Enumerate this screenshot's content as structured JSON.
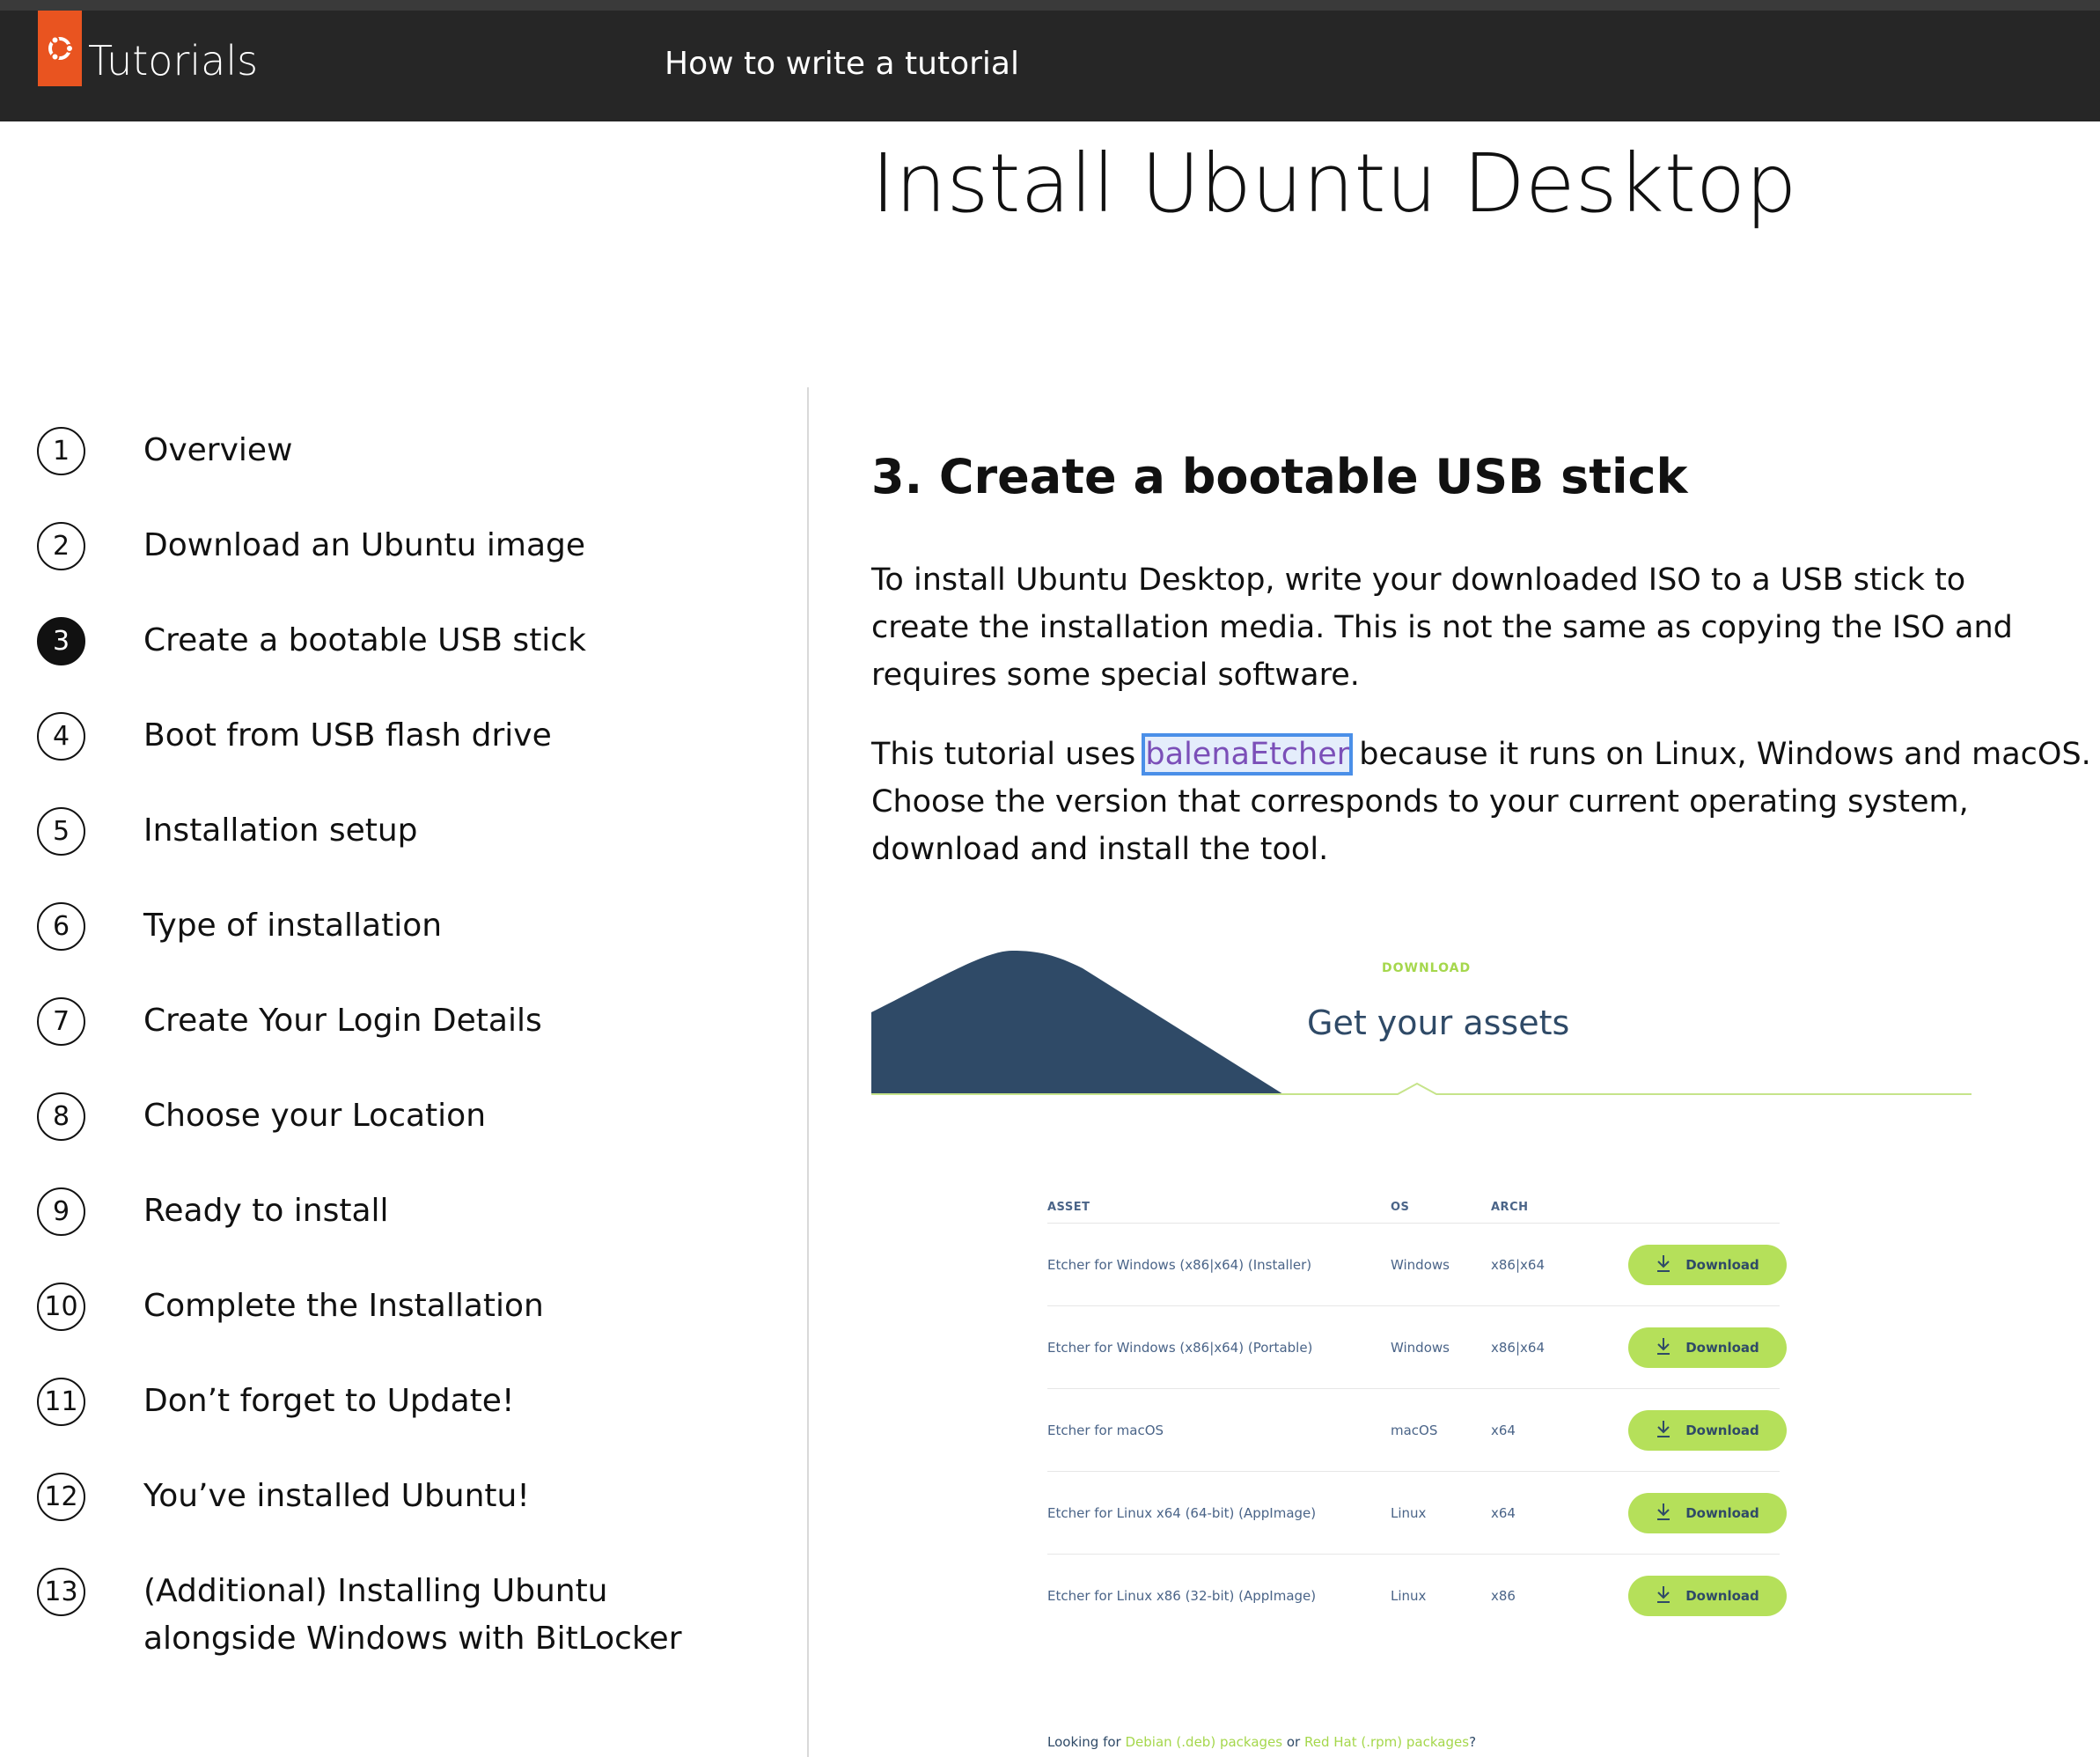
{
  "header": {
    "brand_label": "Tutorials",
    "nav_link": "How to write a tutorial"
  },
  "page": {
    "title": "Install Ubuntu Desktop"
  },
  "sidebar": {
    "steps": [
      {
        "num": "1",
        "label": "Overview"
      },
      {
        "num": "2",
        "label": "Download an Ubuntu image"
      },
      {
        "num": "3",
        "label": "Create a bootable USB stick"
      },
      {
        "num": "4",
        "label": "Boot from USB flash drive"
      },
      {
        "num": "5",
        "label": "Installation setup"
      },
      {
        "num": "6",
        "label": "Type of installation"
      },
      {
        "num": "7",
        "label": "Create Your Login Details"
      },
      {
        "num": "8",
        "label": "Choose your Location"
      },
      {
        "num": "9",
        "label": "Ready to install"
      },
      {
        "num": "10",
        "label": "Complete the Installation"
      },
      {
        "num": "11",
        "label": "Don’t forget to Update!"
      },
      {
        "num": "12",
        "label": "You’ve installed Ubuntu!"
      },
      {
        "num": "13",
        "label": "(Additional) Installing Ubuntu alongside Windows with BitLocker"
      }
    ],
    "active_step": "3"
  },
  "content": {
    "heading": "3. Create a bootable USB stick",
    "para1": "To install Ubuntu Desktop, write your downloaded ISO to a USB stick to create the installation media. This is not the same as copying the ISO and requires some special software.",
    "para2_before": "This tutorial uses ",
    "para2_link": "balenaEtcher",
    "para2_after": " because it runs on Linux, Windows and macOS. Choose the version that corresponds to your current operating system, download and install the tool."
  },
  "screenshot": {
    "eyebrow": "DOWNLOAD",
    "title": "Get your assets",
    "columns": {
      "asset": "ASSET",
      "os": "OS",
      "arch": "ARCH"
    },
    "button_label": "Download",
    "rows": [
      {
        "asset": "Etcher for Windows (x86|x64) (Installer)",
        "os": "Windows",
        "arch": "x86|x64"
      },
      {
        "asset": "Etcher for Windows (x86|x64) (Portable)",
        "os": "Windows",
        "arch": "x86|x64"
      },
      {
        "asset": "Etcher for macOS",
        "os": "macOS",
        "arch": "x64"
      },
      {
        "asset": "Etcher for Linux x64 (64-bit) (AppImage)",
        "os": "Linux",
        "arch": "x64"
      },
      {
        "asset": "Etcher for Linux x86 (32-bit) (AppImage)",
        "os": "Linux",
        "arch": "x86"
      }
    ],
    "footnote_a": "Looking for ",
    "footnote_link1": "Debian (.deb) packages",
    "footnote_b": " or ",
    "footnote_link2": "Red Hat (.rpm) packages",
    "footnote_c": "?"
  },
  "colors": {
    "brand_orange": "#e95420",
    "navbar": "#262626",
    "link_purple": "#7b4fb8",
    "etcher_green": "#b5e05a",
    "etcher_navy": "#2f4a67"
  }
}
